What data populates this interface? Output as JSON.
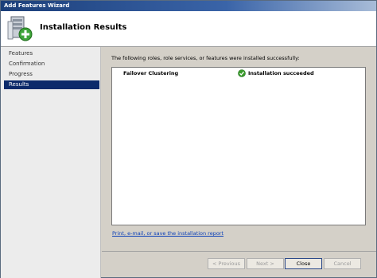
{
  "window": {
    "title": "Add Features Wizard"
  },
  "header": {
    "title": "Installation Results",
    "icon": "server-add-icon"
  },
  "sidebar": {
    "items": [
      {
        "label": "Features",
        "active": false
      },
      {
        "label": "Confirmation",
        "active": false
      },
      {
        "label": "Progress",
        "active": false
      },
      {
        "label": "Results",
        "active": true
      }
    ]
  },
  "main": {
    "intro_text": "The following roles, role services, or features were installed successfully:",
    "results": [
      {
        "name": "Failover Clustering",
        "status": "Installation succeeded",
        "status_icon": "check-circle-icon",
        "status_color": "#3a9b2c"
      }
    ],
    "report_link": "Print, e-mail, or save the installation report"
  },
  "buttons": {
    "previous": {
      "label": "< Previous",
      "enabled": false
    },
    "next": {
      "label": "Next >",
      "enabled": false
    },
    "close": {
      "label": "Close",
      "enabled": true
    },
    "cancel": {
      "label": "Cancel",
      "enabled": false
    }
  },
  "colors": {
    "title_bar": "#1c3f7a",
    "selected_nav": "#0c2a6a",
    "link": "#0a3fb8",
    "success": "#3a9b2c"
  }
}
